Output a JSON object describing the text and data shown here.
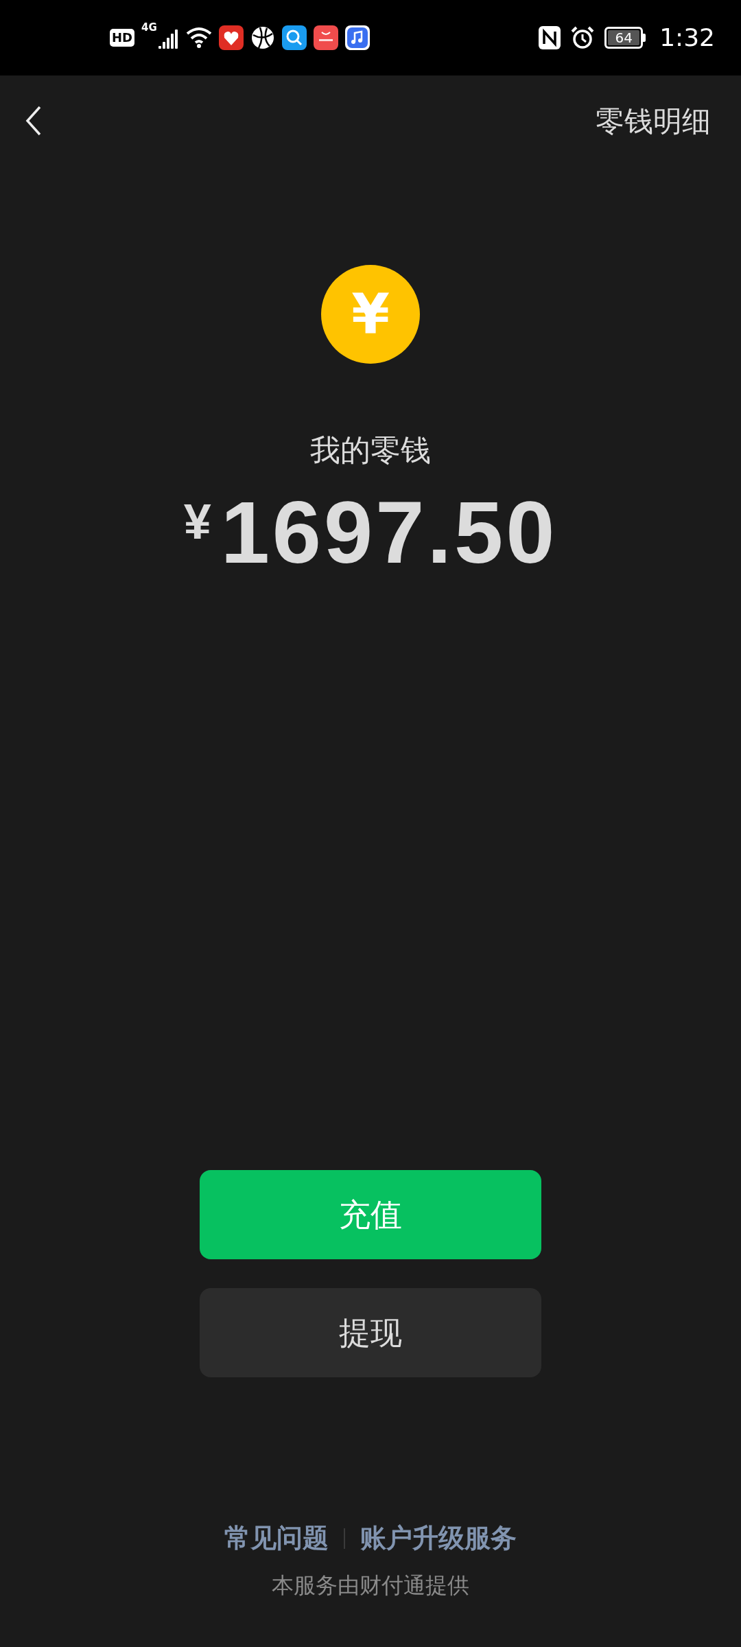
{
  "status_bar": {
    "hd": "HD",
    "network": "4G",
    "battery": "64",
    "time": "1:32"
  },
  "nav": {
    "action": "零钱明细"
  },
  "balance": {
    "currency_icon": "¥",
    "label": "我的零钱",
    "currency": "¥",
    "amount": "1697.50"
  },
  "buttons": [
    {
      "label": "充值",
      "kind": "primary"
    },
    {
      "label": "提现",
      "kind": "secondary"
    }
  ],
  "footer": {
    "links": [
      "常见问题",
      "账户升级服务"
    ],
    "provider": "本服务由财付通提供"
  }
}
